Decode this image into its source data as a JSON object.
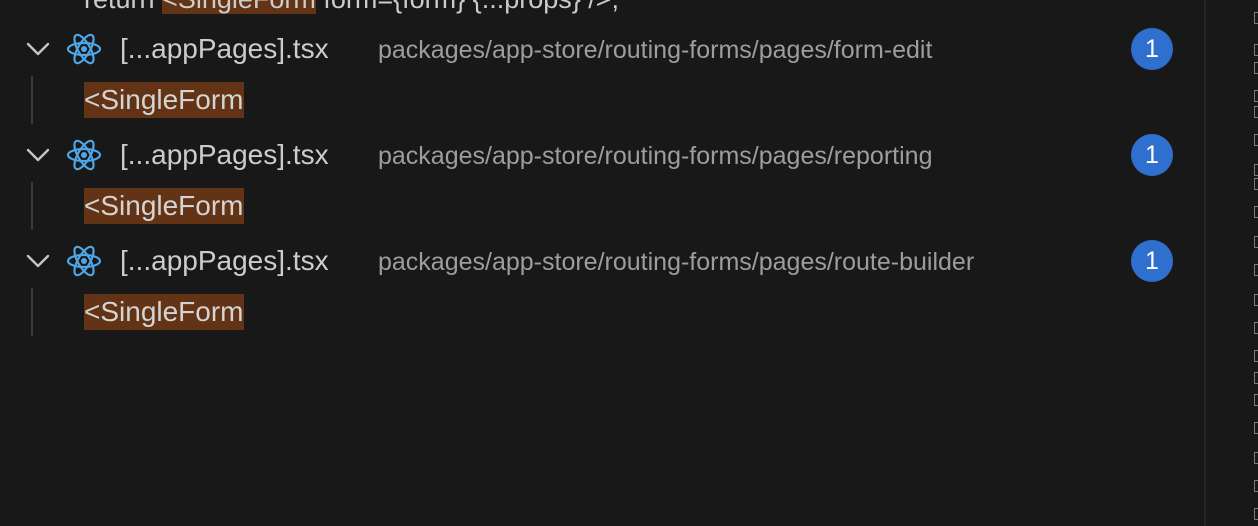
{
  "partial_line": {
    "prefix": "return ",
    "highlight": "<SingleForm",
    "suffix": " form={form} {...props} />;"
  },
  "results": [
    {
      "filename": "[...appPages].tsx",
      "path": "packages/app-store/routing-forms/pages/form-edit",
      "count": "1",
      "match": "<SingleForm"
    },
    {
      "filename": "[...appPages].tsx",
      "path": "packages/app-store/routing-forms/pages/reporting",
      "count": "1",
      "match": "<SingleForm"
    },
    {
      "filename": "[...appPages].tsx",
      "path": "packages/app-store/routing-forms/pages/route-builder",
      "count": "1",
      "match": "<SingleForm"
    }
  ],
  "icons": {
    "chevron": "chevron-down-icon",
    "file": "react-icon"
  },
  "colors": {
    "background": "#181818",
    "react_icon": "#4fa6e8",
    "badge": "#2f6fce",
    "match_highlight": "#623315",
    "path_text": "#9d9d9d"
  }
}
